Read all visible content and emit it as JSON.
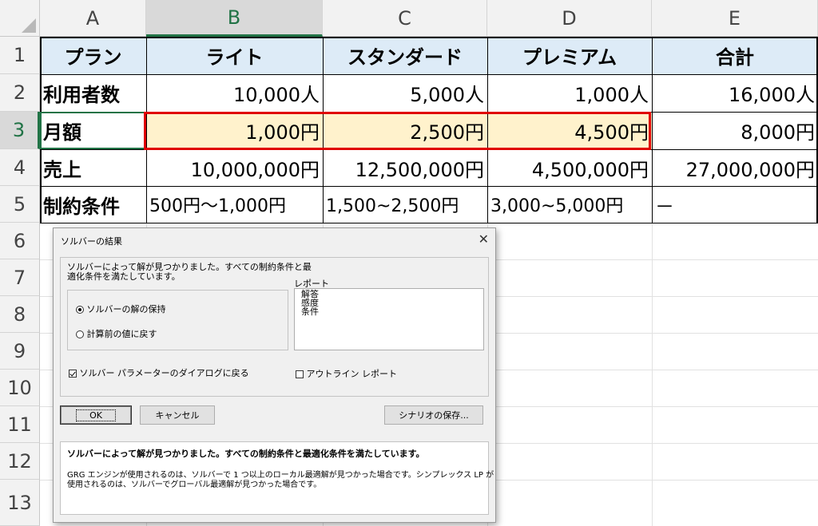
{
  "spreadsheet": {
    "columns": [
      "A",
      "B",
      "C",
      "D",
      "E"
    ],
    "rows": [
      "1",
      "2",
      "3",
      "4",
      "5",
      "6",
      "7",
      "8",
      "9",
      "10",
      "11",
      "12",
      "13"
    ],
    "header_row": [
      "プラン",
      "ライト",
      "スタンダード",
      "プレミアム",
      "合計"
    ],
    "row2": [
      "利用者数",
      "10,000人",
      "5,000人",
      "1,000人",
      "16,000人"
    ],
    "row3": [
      "月額",
      "1,000円",
      "2,500円",
      "4,500円",
      "8,000円"
    ],
    "row4": [
      "売上",
      "10,000,000円",
      "12,500,000円",
      "4,500,000円",
      "27,000,000円"
    ],
    "row5": [
      "制約条件",
      "500円～1,000円",
      "1,500~2,500円",
      "3,000~5,000円",
      "－"
    ],
    "colors": {
      "header_fill": "#ddebf7",
      "changed_fill": "#fff2cc",
      "highlight_border": "#e00000",
      "select_green": "#217346"
    }
  },
  "dialog": {
    "title": "ソルバーの結果",
    "close_icon": "close-icon",
    "message_line1": "ソルバーによって解が見つかりました。すべての制約条件と最",
    "message_line2": "適化条件を満たしています。",
    "option_keep": "ソルバーの解の保持",
    "option_restore": "計算前の値に戻す",
    "reports_label": "レポート",
    "reports": [
      "解答",
      "感度",
      "条件"
    ],
    "return_dialog_label": "ソルバー パラメーターのダイアログに戻る",
    "outline_report_label": "アウトライン レポート",
    "ok_label": "OK",
    "cancel_label": "キャンセル",
    "save_scenario_label": "シナリオの保存...",
    "result_title": "ソルバーによって解が見つかりました。すべての制約条件と最適化条件を満たしています。",
    "result_detail1": "GRG エンジンが使用されるのは、ソルバーで 1 つ以上のローカル最適解が見つかった場合です。シンプレックス LP が",
    "result_detail2": "使用されるのは、ソルバーでグローバル最適解が見つかった場合です。"
  }
}
